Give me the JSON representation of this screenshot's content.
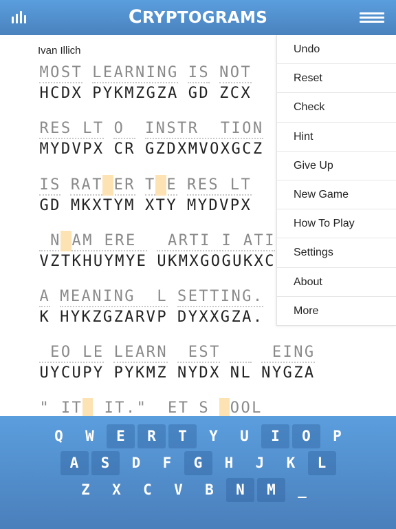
{
  "header": {
    "title_first": "C",
    "title_rest": "RYPTOGRAMS",
    "stats_icon": "bar-chart-icon",
    "menu_icon": "hamburger-menu-icon"
  },
  "puzzle": {
    "author": "Ivan Illich",
    "lines": [
      [
        {
          "guess": "MOST",
          "cipher": "HCDX",
          "hl": []
        },
        {
          "guess": "LEARNING",
          "cipher": "PYKMZGZA",
          "hl": []
        },
        {
          "guess": "IS",
          "cipher": "GD",
          "hl": []
        },
        {
          "guess": "NOT",
          "cipher": "ZCX",
          "hl": []
        }
      ],
      [
        {
          "guess": "RES LT",
          "cipher": "MYDVPX",
          "hl": []
        },
        {
          "guess": "O ",
          "cipher": "CR",
          "hl": []
        },
        {
          "guess": "INSTR  TION",
          "cipher": "GZDXMVOXGCZ",
          "hl": []
        }
      ],
      [
        {
          "guess": "IS",
          "cipher": "GD",
          "hl": []
        },
        {
          "guess": "RAT ER",
          "cipher": "MKXTYM",
          "hl": [
            3
          ]
        },
        {
          "guess": "T E",
          "cipher": "XTY",
          "hl": [
            1
          ]
        },
        {
          "guess": "RES LT",
          "cipher": "MYDVPX",
          "hl": []
        }
      ],
      [
        {
          "guess": " N AM ERE ",
          "cipher": "VZTKHUYMYE",
          "hl": [
            2
          ]
        },
        {
          "guess": " ARTI I ATI",
          "cipher": "UKMXGOGUKXC",
          "hl": []
        }
      ],
      [
        {
          "guess": "A",
          "cipher": "K",
          "hl": []
        },
        {
          "guess": "MEANING  L",
          "cipher": "HYKZGZARVP",
          "hl": []
        },
        {
          "guess": "SETTING.",
          "cipher": "DYXXGZA.",
          "hl": []
        }
      ],
      [
        {
          "guess": " EO LE",
          "cipher": "UYCUPY",
          "hl": []
        },
        {
          "guess": "LEARN",
          "cipher": "PYKMZ",
          "hl": []
        },
        {
          "guess": " EST",
          "cipher": "NYDX",
          "hl": []
        },
        {
          "guess": "  ",
          "cipher": "NL",
          "hl": []
        },
        {
          "guess": " EING",
          "cipher": "NYGZA",
          "hl": []
        }
      ],
      [
        {
          "guess": "\" IT  IT.\"",
          "cipher": "",
          "hl": [
            4
          ]
        },
        {
          "guess": " ET",
          "cipher": "",
          "hl": []
        },
        {
          "guess": "S",
          "cipher": "",
          "hl": []
        },
        {
          "guess": " OOL",
          "cipher": "",
          "hl": [
            0
          ]
        }
      ]
    ]
  },
  "menu": {
    "items": [
      "Undo",
      "Reset",
      "Check",
      "Hint",
      "Give Up",
      "New Game",
      "How To Play",
      "Settings",
      "About",
      "More"
    ]
  },
  "keyboard": {
    "rows": [
      [
        {
          "k": "Q",
          "used": false
        },
        {
          "k": "W",
          "used": false
        },
        {
          "k": "E",
          "used": true
        },
        {
          "k": "R",
          "used": true
        },
        {
          "k": "T",
          "used": true
        },
        {
          "k": "Y",
          "used": false
        },
        {
          "k": "U",
          "used": false
        },
        {
          "k": "I",
          "used": true
        },
        {
          "k": "O",
          "used": true
        },
        {
          "k": "P",
          "used": false
        }
      ],
      [
        {
          "k": "A",
          "used": true
        },
        {
          "k": "S",
          "used": true
        },
        {
          "k": "D",
          "used": false
        },
        {
          "k": "F",
          "used": false
        },
        {
          "k": "G",
          "used": true
        },
        {
          "k": "H",
          "used": false
        },
        {
          "k": "J",
          "used": false
        },
        {
          "k": "K",
          "used": false
        },
        {
          "k": "L",
          "used": true
        }
      ],
      [
        {
          "k": "Z",
          "used": false
        },
        {
          "k": "X",
          "used": false
        },
        {
          "k": "C",
          "used": false
        },
        {
          "k": "V",
          "used": false
        },
        {
          "k": "B",
          "used": false
        },
        {
          "k": "N",
          "used": true
        },
        {
          "k": "M",
          "used": true
        },
        {
          "k": "_",
          "used": false
        }
      ]
    ]
  },
  "colors": {
    "header_blue": "#5a9ede",
    "highlight": "#fde3b4",
    "guess_text": "#8a8a8a",
    "cipher_text": "#222222"
  }
}
